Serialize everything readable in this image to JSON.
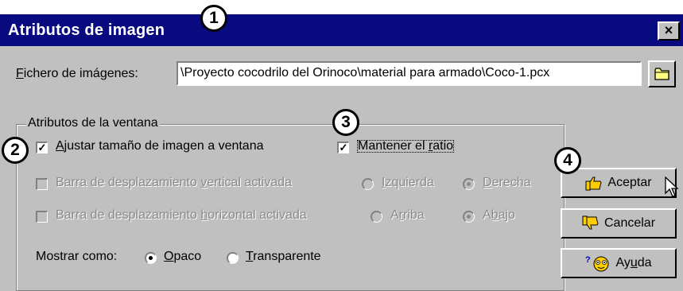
{
  "window": {
    "title": "Atributos de imagen",
    "close_glyph": "×"
  },
  "file": {
    "label_prefix": "",
    "label_access": "F",
    "label_rest": "ichero de imágenes:",
    "value": "\\Proyecto cocodrilo del Orinoco\\material para armado\\Coco-1.pcx",
    "browse_icon": "folder-icon"
  },
  "group": {
    "label": "Atributos de la ventana"
  },
  "options": {
    "adjust_pre": "",
    "adjust_access": "A",
    "adjust_rest": "justar tamaño de imagen a ventana",
    "adjust_checked": true,
    "ratio_pre": "Mantener el ",
    "ratio_access": "r",
    "ratio_rest": "atio",
    "ratio_checked": true,
    "vscroll_pre": "Barra de desplazamiento ",
    "vscroll_access": "v",
    "vscroll_rest": "ertical activada",
    "left_access": "I",
    "left_rest": "zquierda",
    "right_access": "D",
    "right_rest": "erecha",
    "hscroll_pre": "Barra de desplazamiento ",
    "hscroll_access": "h",
    "hscroll_rest": "orizontal activada",
    "top_pre": "A",
    "top_access": "r",
    "top_rest": "riba",
    "bottom_pre": "A",
    "bottom_access": "b",
    "bottom_rest": "ajo",
    "show_label": "Mostrar como:",
    "opaque_access": "O",
    "opaque_rest": "paco",
    "transparent_access": "T",
    "transparent_rest": "ransparente"
  },
  "buttons": {
    "accept": "Aceptar",
    "cancel": "Cancelar",
    "help_pre": "Ay",
    "help_access": "u",
    "help_rest": "da"
  },
  "callouts": [
    "1",
    "2",
    "3",
    "4"
  ],
  "colors": {
    "titlebar": "#0a0a80",
    "face": "#c0c0c0",
    "disabled_text": "#8a8a8a"
  }
}
